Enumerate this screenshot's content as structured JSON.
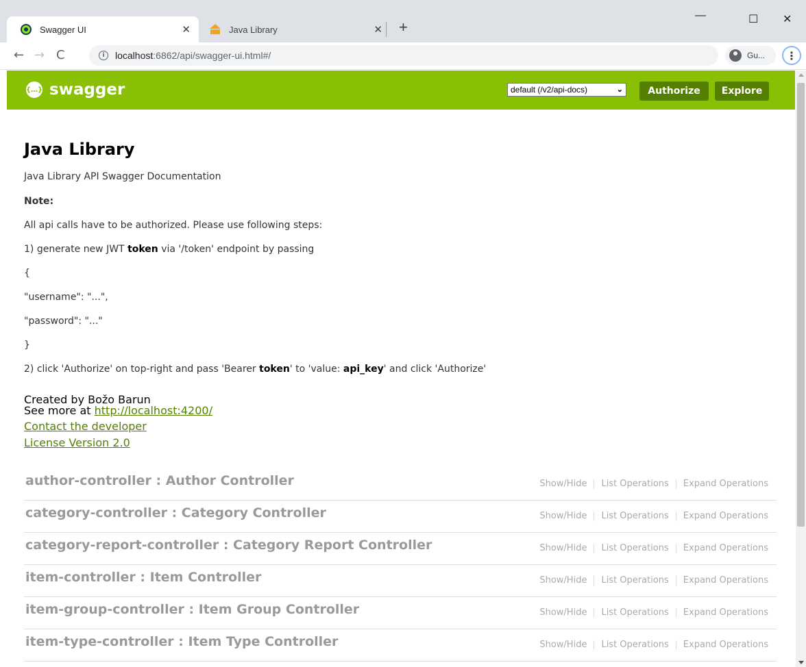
{
  "browser": {
    "tabs": [
      {
        "title": "Swagger UI",
        "favicon": "swagger-favicon",
        "close": "✕"
      },
      {
        "title": "Java Library",
        "favicon": "library-favicon",
        "close": "✕"
      }
    ],
    "new_tab": "+",
    "window_controls": {
      "minimize": "—",
      "maximize": "☐",
      "close": "✕"
    },
    "nav": {
      "back": "←",
      "forward": "→",
      "reload": "C"
    },
    "url_host": "localhost",
    "url_rest": ":6862/api/swagger-ui.html#/",
    "profile_label": "Gu...",
    "menu": "⋮"
  },
  "swagger": {
    "logo_icon": "{…}",
    "logo_text": "swagger",
    "spec_select": "default (/v2/api-docs)",
    "authorize_label": "Authorize",
    "explore_label": "Explore",
    "brand_color": "#89bf04"
  },
  "info": {
    "title": "Java Library",
    "description": "Java Library API Swagger Documentation",
    "note": "Note:",
    "line_auth": "All api calls have to be authorized. Please use following steps:",
    "step1_a": "1) generate new JWT ",
    "step1_b": "token",
    "step1_c": " via '/token' endpoint by passing",
    "brace_open": "{",
    "username_line": "\"username\": \"...\",",
    "password_line": "\"password\": \"...\"",
    "brace_close": "}",
    "step2_a": "2) click 'Authorize' on top-right and pass 'Bearer ",
    "step2_b": "token",
    "step2_c": "' to 'value: ",
    "step2_d": "api_key",
    "step2_e": "' and click 'Authorize'",
    "created_by": "Created by Božo Barun",
    "see_more": "See more at ",
    "see_more_link": "http://localhost:4200/",
    "contact": "Contact the developer",
    "license": "License Version 2.0"
  },
  "resources": [
    {
      "name": "author-controller : Author Controller"
    },
    {
      "name": "category-controller : Category Controller"
    },
    {
      "name": "category-report-controller : Category Report Controller"
    },
    {
      "name": "item-controller : Item Controller"
    },
    {
      "name": "item-group-controller : Item Group Controller"
    },
    {
      "name": "item-type-controller : Item Type Controller"
    }
  ],
  "resource_ops": {
    "show_hide": "Show/Hide",
    "list": "List Operations",
    "expand": "Expand Operations"
  }
}
